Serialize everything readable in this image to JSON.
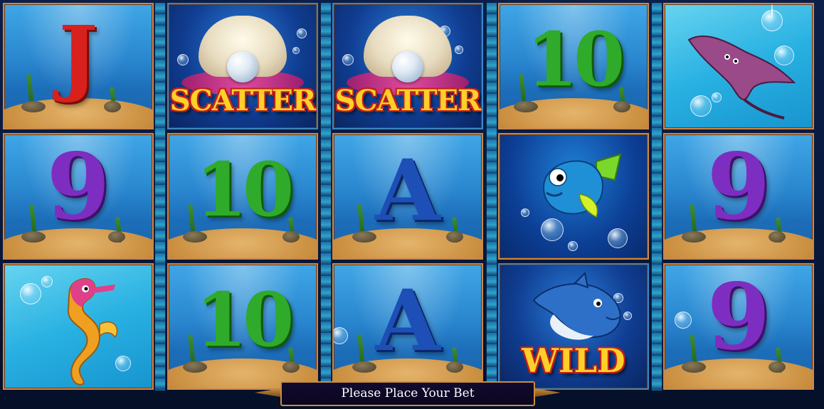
{
  "game": {
    "type": "slot-machine",
    "theme": "underwater"
  },
  "reels": [
    [
      {
        "symbol": "J",
        "kind": "letter",
        "label": "J"
      },
      {
        "symbol": "9",
        "kind": "number",
        "label": "9"
      },
      {
        "symbol": "seahorse",
        "kind": "creature",
        "label": ""
      }
    ],
    [
      {
        "symbol": "scatter",
        "kind": "special",
        "label": "SCATTER"
      },
      {
        "symbol": "10",
        "kind": "number",
        "label": "10"
      },
      {
        "symbol": "10",
        "kind": "number",
        "label": "10"
      }
    ],
    [
      {
        "symbol": "scatter",
        "kind": "special",
        "label": "SCATTER"
      },
      {
        "symbol": "A",
        "kind": "letter",
        "label": "A"
      },
      {
        "symbol": "A",
        "kind": "letter",
        "label": "A"
      }
    ],
    [
      {
        "symbol": "10",
        "kind": "number",
        "label": "10"
      },
      {
        "symbol": "fish",
        "kind": "creature",
        "label": ""
      },
      {
        "symbol": "wild",
        "kind": "special",
        "label": "WILD"
      }
    ],
    [
      {
        "symbol": "stingray",
        "kind": "creature",
        "label": ""
      },
      {
        "symbol": "9",
        "kind": "number",
        "label": "9"
      },
      {
        "symbol": "9",
        "kind": "number",
        "label": "9"
      }
    ]
  ],
  "status_message": "Please Place Your Bet",
  "colors": {
    "letter_j": "#d8201c",
    "number_9": "#7d2ec0",
    "number_10": "#2faa2a",
    "letter_a": "#1d4fb6",
    "special_text": "#ffd02a",
    "frame": "#c9894a"
  }
}
